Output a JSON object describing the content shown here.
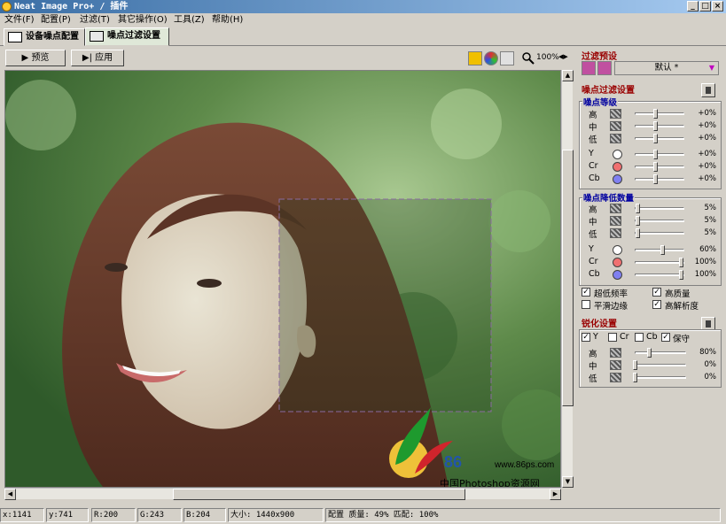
{
  "window": {
    "title": "Neat Image Pro+ / 插件"
  },
  "menu": [
    "文件(F)",
    "配置(P)",
    "过滤(T)",
    "其它操作(O)",
    "工具(Z)",
    "帮助(H)"
  ],
  "tabs": [
    {
      "label": "设备噪点配置",
      "active": false
    },
    {
      "label": "噪点过滤设置",
      "active": true
    }
  ],
  "toolbar": {
    "preview_label": "预览",
    "apply_label": "应用",
    "zoom": "100%"
  },
  "preset": {
    "section_title": "过滤预设",
    "value": "默认 *"
  },
  "noise_filter": {
    "section_title": "噪点过滤设置",
    "levels": {
      "title": "噪点等级",
      "rows": [
        {
          "label": "高",
          "value": "+0%",
          "pos": 0.45
        },
        {
          "label": "中",
          "value": "+0%",
          "pos": 0.45
        },
        {
          "label": "低",
          "value": "+0%",
          "pos": 0.45
        },
        {
          "label": "Y",
          "value": "+0%",
          "pos": 0.45,
          "color": "#ffffff"
        },
        {
          "label": "Cr",
          "value": "+0%",
          "pos": 0.45,
          "color": "#f07070"
        },
        {
          "label": "Cb",
          "value": "+0%",
          "pos": 0.45,
          "color": "#8080f0"
        }
      ]
    },
    "reduction": {
      "title": "噪点降低数量",
      "rows": [
        {
          "label": "高",
          "value": "5%",
          "pos": 0.05
        },
        {
          "label": "中",
          "value": "5%",
          "pos": 0.05
        },
        {
          "label": "低",
          "value": "5%",
          "pos": 0.05
        },
        {
          "label": "Y",
          "value": "60%",
          "pos": 0.6,
          "color": "#ffffff"
        },
        {
          "label": "Cr",
          "value": "100%",
          "pos": 1.0,
          "color": "#f07070"
        },
        {
          "label": "Cb",
          "value": "100%",
          "pos": 1.0,
          "color": "#8080f0"
        }
      ]
    },
    "options": [
      {
        "label": "超低频率",
        "checked": true
      },
      {
        "label": "高质量",
        "checked": true
      },
      {
        "label": "平滑边缘",
        "checked": false
      },
      {
        "label": "高解析度",
        "checked": true
      }
    ]
  },
  "sharpen": {
    "section_title": "锐化设置",
    "channels": [
      {
        "label": "Y",
        "checked": true
      },
      {
        "label": "Cr",
        "checked": false
      },
      {
        "label": "Cb",
        "checked": false
      },
      {
        "label": "保守",
        "checked": true
      }
    ],
    "rows": [
      {
        "label": "高",
        "value": "80%",
        "pos": 0.3
      },
      {
        "label": "中",
        "value": "0%",
        "pos": 0.0
      },
      {
        "label": "低",
        "value": "0%",
        "pos": 0.0
      }
    ]
  },
  "watermark": {
    "site": "www.86ps.com",
    "logo_text": "86",
    "caption": "中国Photoshop资源网"
  },
  "status": {
    "x": "x:1141",
    "y": "y:741",
    "r": "R:200",
    "g": "G:243",
    "b": "B:204",
    "size": "大小: 1440x900",
    "profile": "配置 质量: 49%  匹配: 100%"
  },
  "colors": {
    "accent_title": "#990000",
    "group_title": "#0000a0",
    "active_tab": "#dfe8d8"
  }
}
